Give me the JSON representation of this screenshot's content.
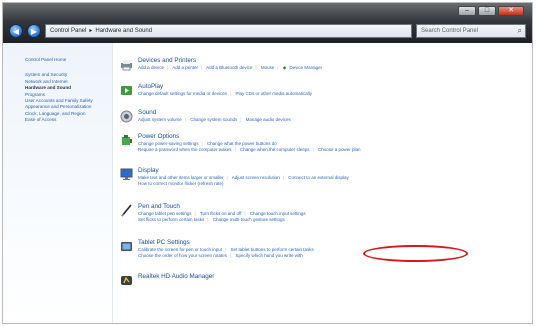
{
  "window": {
    "controls": [
      "–",
      "□",
      "✕"
    ]
  },
  "nav": {
    "back_glyph": "◀",
    "forward_glyph": "▶",
    "breadcrumb": [
      "Control Panel",
      "Hardware and Sound"
    ],
    "search_placeholder": "Search Control Panel",
    "search_icon": "search-icon"
  },
  "left_pane": {
    "home": "Control Panel Home",
    "items": [
      "System and Security",
      "Network and Internet",
      "Hardware and Sound",
      "Programs",
      "User Accounts and Family Safety",
      "Appearance and Personalization",
      "Clock, Language, and Region",
      "Ease of Access"
    ],
    "active_index": 2
  },
  "categories": [
    {
      "title": "Devices and Printers",
      "icon": "printer-icon",
      "links": [
        "Add a device",
        "Add a printer",
        "Add a Bluetooth device",
        "Mouse",
        "Device Manager"
      ]
    },
    {
      "title": "AutoPlay",
      "icon": "autoplay-icon",
      "links": [
        "Change default settings for media or devices",
        "Play CDs or other media automatically"
      ]
    },
    {
      "title": "Sound",
      "icon": "speaker-icon",
      "links": [
        "Adjust system volume",
        "Change system sounds",
        "Manage audio devices"
      ]
    },
    {
      "title": "Power Options",
      "icon": "power-icon",
      "links": [
        "Change power-saving settings",
        "Change what the power buttons do",
        "Require a password when the computer wakes",
        "Change when the computer sleeps",
        "Choose a power plan"
      ]
    },
    {
      "title": "Display",
      "icon": "display-icon",
      "links": [
        "Make text and other items larger or smaller",
        "Adjust screen resolution",
        "Connect to an external display",
        "How to correct monitor flicker (refresh rate)"
      ]
    },
    {
      "title": "Pen and Touch",
      "icon": "pen-icon",
      "links": [
        "Change tablet pen settings",
        "Turn flicks on and off",
        "Change touch input settings",
        "Set flicks to perform certain tasks",
        "Change multi-touch gesture settings"
      ]
    },
    {
      "title": "Tablet PC Settings",
      "icon": "tablet-icon",
      "links": [
        "Calibrate the screen for pen or touch input",
        "Set tablet buttons to perform certain tasks",
        "Choose the order of how your screen rotates",
        "Specify which hand you write with"
      ]
    },
    {
      "title": "Realtek HD Audio Manager",
      "icon": "realtek-audio-icon",
      "links": []
    }
  ],
  "colors": {
    "link": "#2b66c0",
    "title": "#1a4e9a",
    "highlight_circle": "#d8141c"
  }
}
